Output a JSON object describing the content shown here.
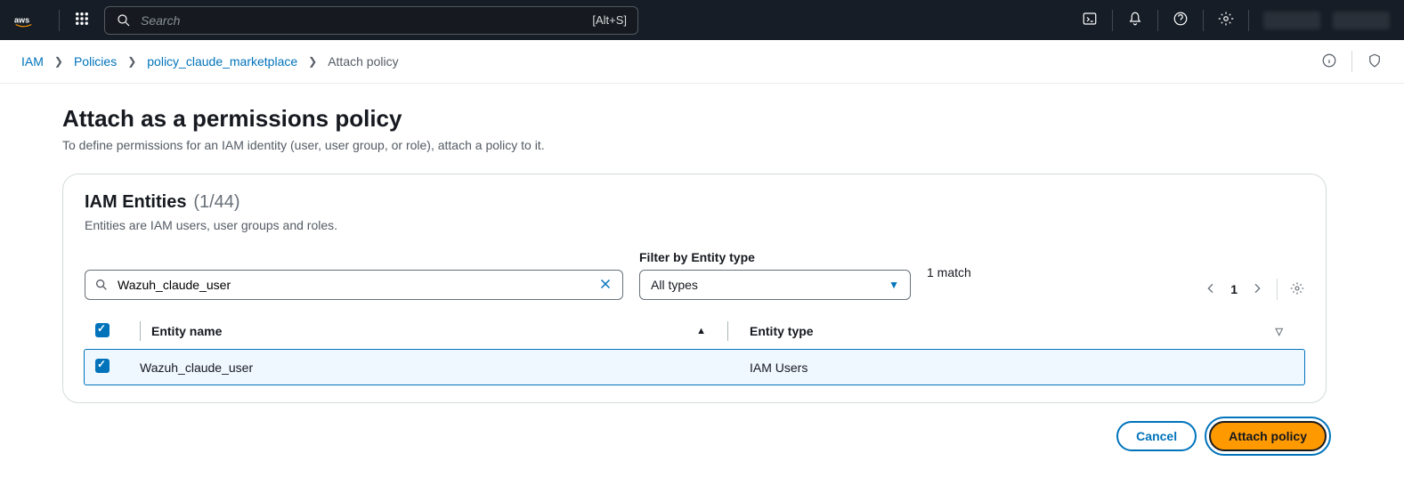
{
  "nav": {
    "logo_text": "aws",
    "search_placeholder": "Search",
    "search_shortcut": "[Alt+S]"
  },
  "breadcrumb": {
    "items": [
      {
        "label": "IAM"
      },
      {
        "label": "Policies"
      },
      {
        "label": "policy_claude_marketplace"
      }
    ],
    "current": "Attach policy"
  },
  "page": {
    "title": "Attach as a permissions policy",
    "subtitle": "To define permissions for an IAM identity (user, user group, or role), attach a policy to it."
  },
  "panel": {
    "title": "IAM Entities",
    "count": "(1/44)",
    "desc": "Entities are IAM users, user groups and roles.",
    "filter_label": "Filter by Entity type",
    "search_value": "Wazuh_claude_user",
    "type_value": "All types",
    "match_text": "1 match",
    "page_number": "1"
  },
  "table": {
    "col_name": "Entity name",
    "col_type": "Entity type",
    "rows": [
      {
        "name": "Wazuh_claude_user",
        "type": "IAM Users",
        "selected": true
      }
    ]
  },
  "actions": {
    "cancel": "Cancel",
    "attach": "Attach policy"
  }
}
